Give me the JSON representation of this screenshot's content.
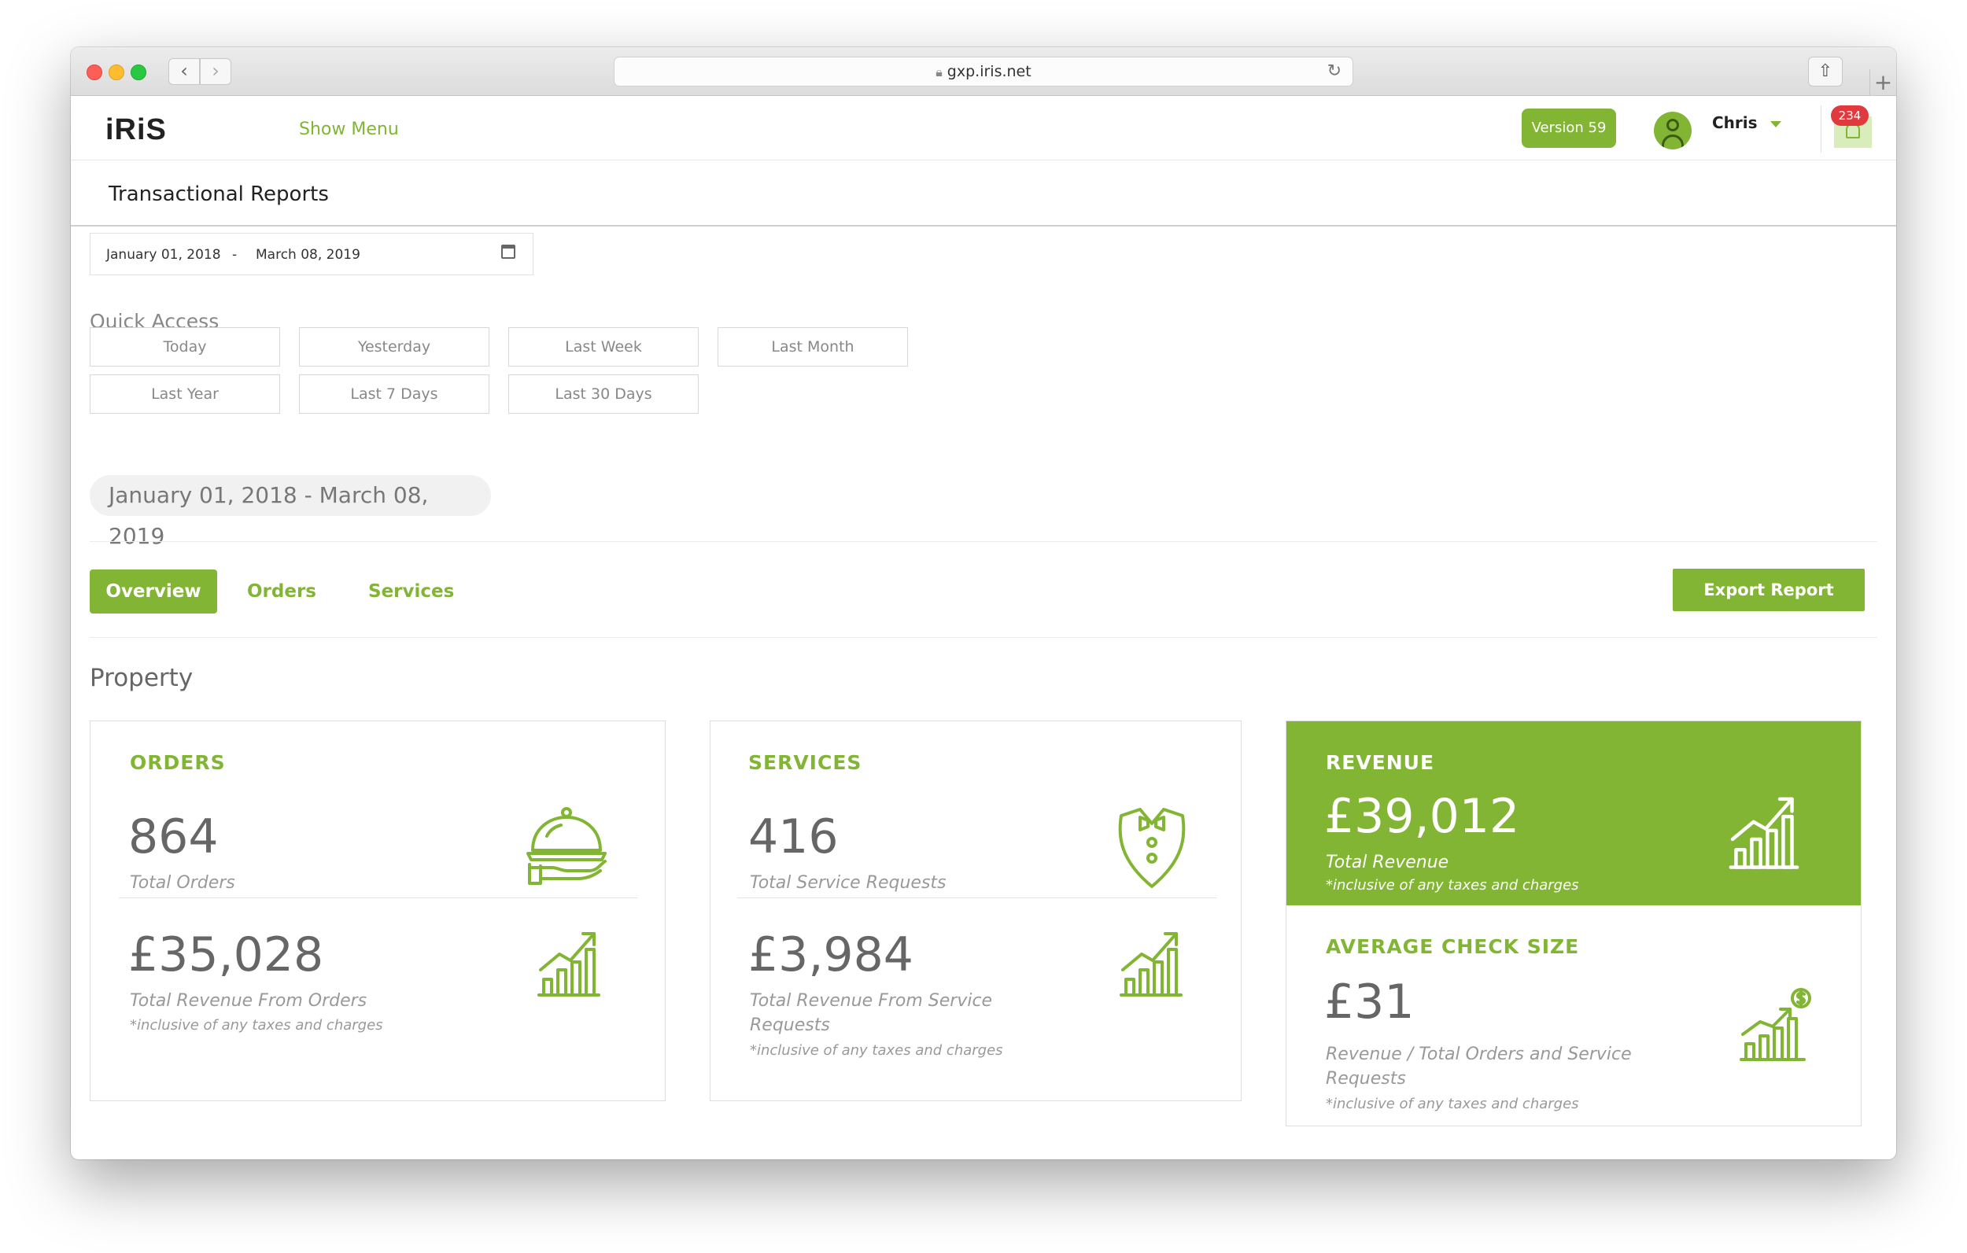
{
  "browser": {
    "url": "gxp.iris.net",
    "back_icon": "‹",
    "forward_icon": "›"
  },
  "header": {
    "logo": "iRiS",
    "show_menu": "Show Menu",
    "version": "Version 59",
    "user_name": "Chris",
    "notification_count": "234"
  },
  "page": {
    "title": "Transactional Reports"
  },
  "date_range": {
    "from": "January 01, 2018",
    "separator": "-",
    "to": "March 08, 2019",
    "summary": "January 01, 2018 - March 08, 2019"
  },
  "quick_access": {
    "label": "Quick Access",
    "buttons": [
      "Today",
      "Yesterday",
      "Last Week",
      "Last Month",
      "Last Year",
      "Last 7 Days",
      "Last 30 Days"
    ]
  },
  "tabs": {
    "overview": "Overview",
    "orders": "Orders",
    "services": "Services",
    "export": "Export Report"
  },
  "property": {
    "title": "Property",
    "orders": {
      "title": "ORDERS",
      "total": "864",
      "total_label": "Total Orders",
      "revenue": "£35,028",
      "revenue_label": "Total Revenue From Orders",
      "note": "*inclusive of any taxes and charges"
    },
    "services": {
      "title": "SERVICES",
      "total": "416",
      "total_label": "Total Service Requests",
      "revenue": "£3,984",
      "revenue_label_1": "Total Revenue From Service",
      "revenue_label_2": "Requests",
      "note": "*inclusive of any taxes and charges"
    },
    "revenue": {
      "title": "REVENUE",
      "total": "£39,012",
      "total_label": "Total Revenue",
      "note": "*inclusive of any taxes and charges"
    },
    "average_check": {
      "title": "AVERAGE CHECK SIZE",
      "value": "£31",
      "label_1": "Revenue / Total Orders and Service",
      "label_2": "Requests",
      "note": "*inclusive of any taxes and charges"
    }
  },
  "colors": {
    "accent": "#82b533",
    "badge": "#e0393e"
  }
}
